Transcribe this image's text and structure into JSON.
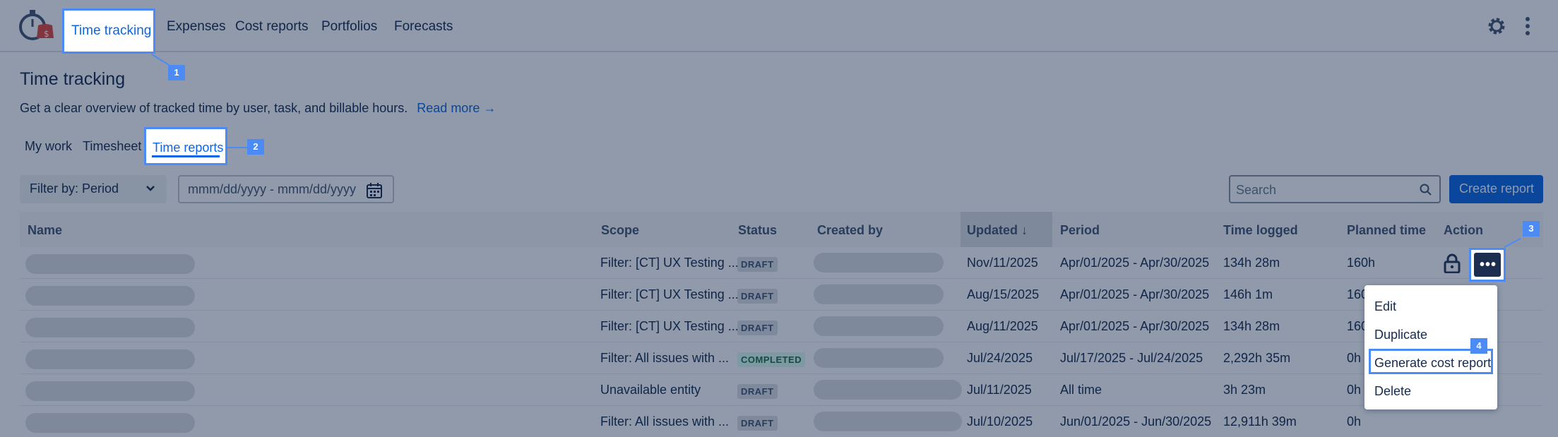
{
  "nav": {
    "items": [
      "Time tracking",
      "Expenses",
      "Cost reports",
      "Portfolios",
      "Forecasts"
    ],
    "active_index": 0
  },
  "page": {
    "title": "Time tracking",
    "description": "Get a clear overview of tracked time by user, task, and billable hours.",
    "read_more": "Read more"
  },
  "tabs": {
    "items": [
      "My work",
      "Timesheet",
      "Time reports"
    ],
    "active_index": 2
  },
  "filters": {
    "filter_by": "Filter by: Period",
    "date_placeholder": "mmm/dd/yyyy - mmm/dd/yyyy",
    "search_placeholder": "Search",
    "create_button": "Create report"
  },
  "table": {
    "columns": [
      "Name",
      "Scope",
      "Status",
      "Created by",
      "Updated",
      "Period",
      "Time logged",
      "Planned time",
      "Action"
    ],
    "sort_indicator": "↓",
    "rows": [
      {
        "scope": "Filter: [CT] UX Testing ...",
        "status": "DRAFT",
        "updated": "Nov/11/2025",
        "period": "Apr/01/2025 - Apr/30/2025",
        "time_logged": "134h 28m",
        "planned": "160h"
      },
      {
        "scope": "Filter: [CT] UX Testing ...",
        "status": "DRAFT",
        "updated": "Aug/15/2025",
        "period": "Apr/01/2025 - Apr/30/2025",
        "time_logged": "146h 1m",
        "planned": "160"
      },
      {
        "scope": "Filter: [CT] UX Testing ...",
        "status": "DRAFT",
        "updated": "Aug/11/2025",
        "period": "Apr/01/2025 - Apr/30/2025",
        "time_logged": "134h 28m",
        "planned": "160"
      },
      {
        "scope": "Filter: All issues with ...",
        "status": "COMPLETED",
        "updated": "Jul/24/2025",
        "period": "Jul/17/2025 - Jul/24/2025",
        "time_logged": "2,292h 35m",
        "planned": "0h"
      },
      {
        "scope": "Unavailable entity",
        "status": "DRAFT",
        "updated": "Jul/11/2025",
        "period": "All time",
        "time_logged": "3h 23m",
        "planned": "0h"
      },
      {
        "scope": "Filter: All issues with ...",
        "status": "DRAFT",
        "updated": "Jul/10/2025",
        "period": "Jun/01/2025 - Jun/30/2025",
        "time_logged": "12,911h 39m",
        "planned": "0h"
      }
    ]
  },
  "action_menu": {
    "button_label": "•••",
    "items": [
      "Edit",
      "Duplicate",
      "Generate cost report",
      "Delete"
    ],
    "highlight_index": 2
  },
  "callouts": [
    "1",
    "2",
    "3",
    "4"
  ],
  "colors": {
    "accent": "#0c66e4",
    "highlight": "#4c8bf5",
    "overlay": "rgba(9,30,66,0.45)"
  }
}
